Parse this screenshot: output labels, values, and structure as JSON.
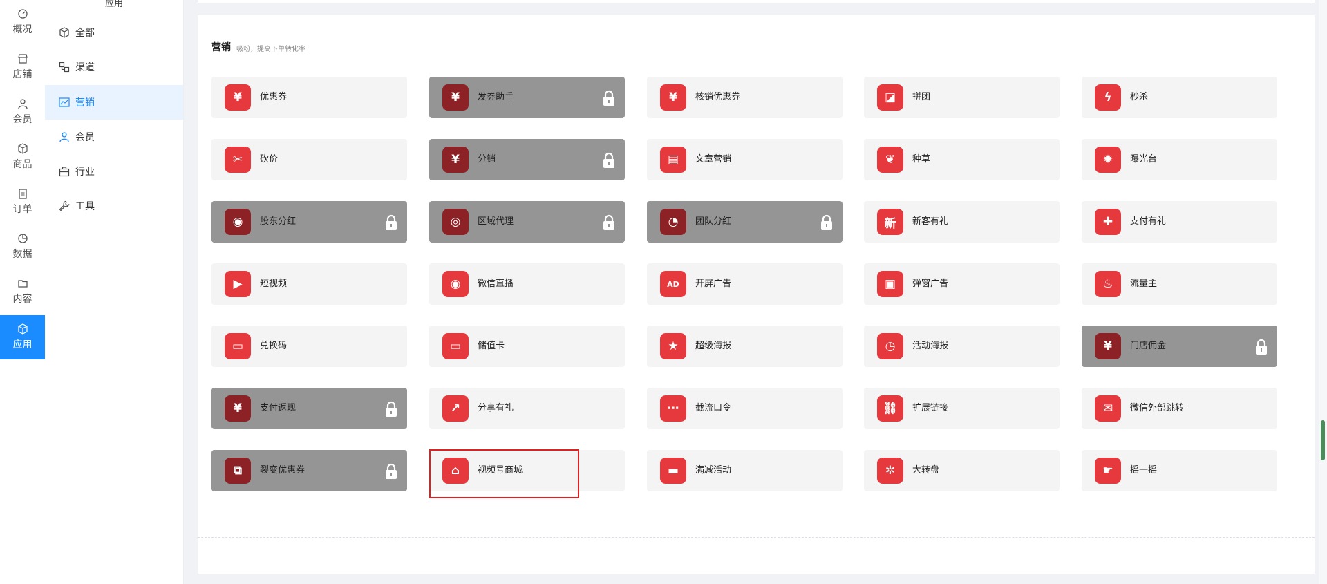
{
  "rail": {
    "items": [
      {
        "label": "概况",
        "icon": "dashboard-icon"
      },
      {
        "label": "店铺",
        "icon": "store-icon"
      },
      {
        "label": "会员",
        "icon": "user-icon"
      },
      {
        "label": "商品",
        "icon": "box-icon"
      },
      {
        "label": "订单",
        "icon": "clipboard-icon"
      },
      {
        "label": "数据",
        "icon": "pie-icon"
      },
      {
        "label": "内容",
        "icon": "folder-icon"
      },
      {
        "label": "应用",
        "icon": "cube-icon",
        "active": true
      }
    ]
  },
  "subnav": {
    "title": "应用",
    "items": [
      {
        "label": "全部",
        "icon": "cube-icon"
      },
      {
        "label": "渠道",
        "icon": "channel-icon"
      },
      {
        "label": "营销",
        "icon": "chart-line-icon",
        "active": true
      },
      {
        "label": "会员",
        "icon": "user-icon"
      },
      {
        "label": "行业",
        "icon": "briefcase-icon"
      },
      {
        "label": "工具",
        "icon": "wrench-icon"
      }
    ]
  },
  "section": {
    "title": "营销",
    "subtitle": "吸粉，提高下单转化率"
  },
  "apps": [
    {
      "label": "优惠券",
      "locked": false,
      "icon": "coupon-icon"
    },
    {
      "label": "发券助手",
      "locked": true,
      "icon": "coupon-helper-icon"
    },
    {
      "label": "核销优惠券",
      "locked": false,
      "icon": "verify-coupon-icon"
    },
    {
      "label": "拼团",
      "locked": false,
      "icon": "group-buy-icon"
    },
    {
      "label": "秒杀",
      "locked": false,
      "icon": "lightning-icon"
    },
    {
      "label": "砍价",
      "locked": false,
      "icon": "price-tag-icon"
    },
    {
      "label": "分销",
      "locked": true,
      "icon": "money-bag-icon"
    },
    {
      "label": "文章营销",
      "locked": false,
      "icon": "article-icon"
    },
    {
      "label": "种草",
      "locked": false,
      "icon": "sprout-icon"
    },
    {
      "label": "曝光台",
      "locked": false,
      "icon": "sun-icon"
    },
    {
      "label": "股东分红",
      "locked": true,
      "icon": "hand-coins-icon"
    },
    {
      "label": "区域代理",
      "locked": true,
      "icon": "coin-stack-icon"
    },
    {
      "label": "团队分红",
      "locked": true,
      "icon": "pie-chart-icon"
    },
    {
      "label": "新客有礼",
      "locked": false,
      "icon": "new-badge-icon"
    },
    {
      "label": "支付有礼",
      "locked": false,
      "icon": "gift-icon"
    },
    {
      "label": "短视频",
      "locked": false,
      "icon": "video-camera-icon"
    },
    {
      "label": "微信直播",
      "locked": false,
      "icon": "live-stream-icon"
    },
    {
      "label": "开屏广告",
      "locked": false,
      "icon": "ad-icon"
    },
    {
      "label": "弹窗广告",
      "locked": false,
      "icon": "popup-ad-icon"
    },
    {
      "label": "流量主",
      "locked": false,
      "icon": "drop-icon"
    },
    {
      "label": "兑换码",
      "locked": false,
      "icon": "redeem-code-icon"
    },
    {
      "label": "储值卡",
      "locked": false,
      "icon": "stored-card-icon"
    },
    {
      "label": "超级海报",
      "locked": false,
      "icon": "star-poster-icon"
    },
    {
      "label": "活动海报",
      "locked": false,
      "icon": "timer-icon"
    },
    {
      "label": "门店佣金",
      "locked": true,
      "icon": "store-commission-icon"
    },
    {
      "label": "支付返现",
      "locked": true,
      "icon": "cashback-icon"
    },
    {
      "label": "分享有礼",
      "locked": false,
      "icon": "share-calendar-icon"
    },
    {
      "label": "截流口令",
      "locked": false,
      "icon": "password-icon"
    },
    {
      "label": "扩展链接",
      "locked": false,
      "icon": "link-icon"
    },
    {
      "label": "微信外部跳转",
      "locked": false,
      "icon": "wechat-icon"
    },
    {
      "label": "裂变优惠券",
      "locked": true,
      "icon": "fission-coupon-icon"
    },
    {
      "label": "视频号商城",
      "locked": false,
      "icon": "video-shop-icon"
    },
    {
      "label": "满减活动",
      "locked": false,
      "icon": "wallet-icon"
    },
    {
      "label": "大转盘",
      "locked": false,
      "icon": "wheel-icon"
    },
    {
      "label": "摇一摇",
      "locked": false,
      "icon": "shake-icon"
    }
  ],
  "colors": {
    "accent": "#1a8cff",
    "icon_red": "#e5393d",
    "icon_red_locked": "#8c2226",
    "locked_card": "#959595",
    "highlight": "#e02020"
  }
}
